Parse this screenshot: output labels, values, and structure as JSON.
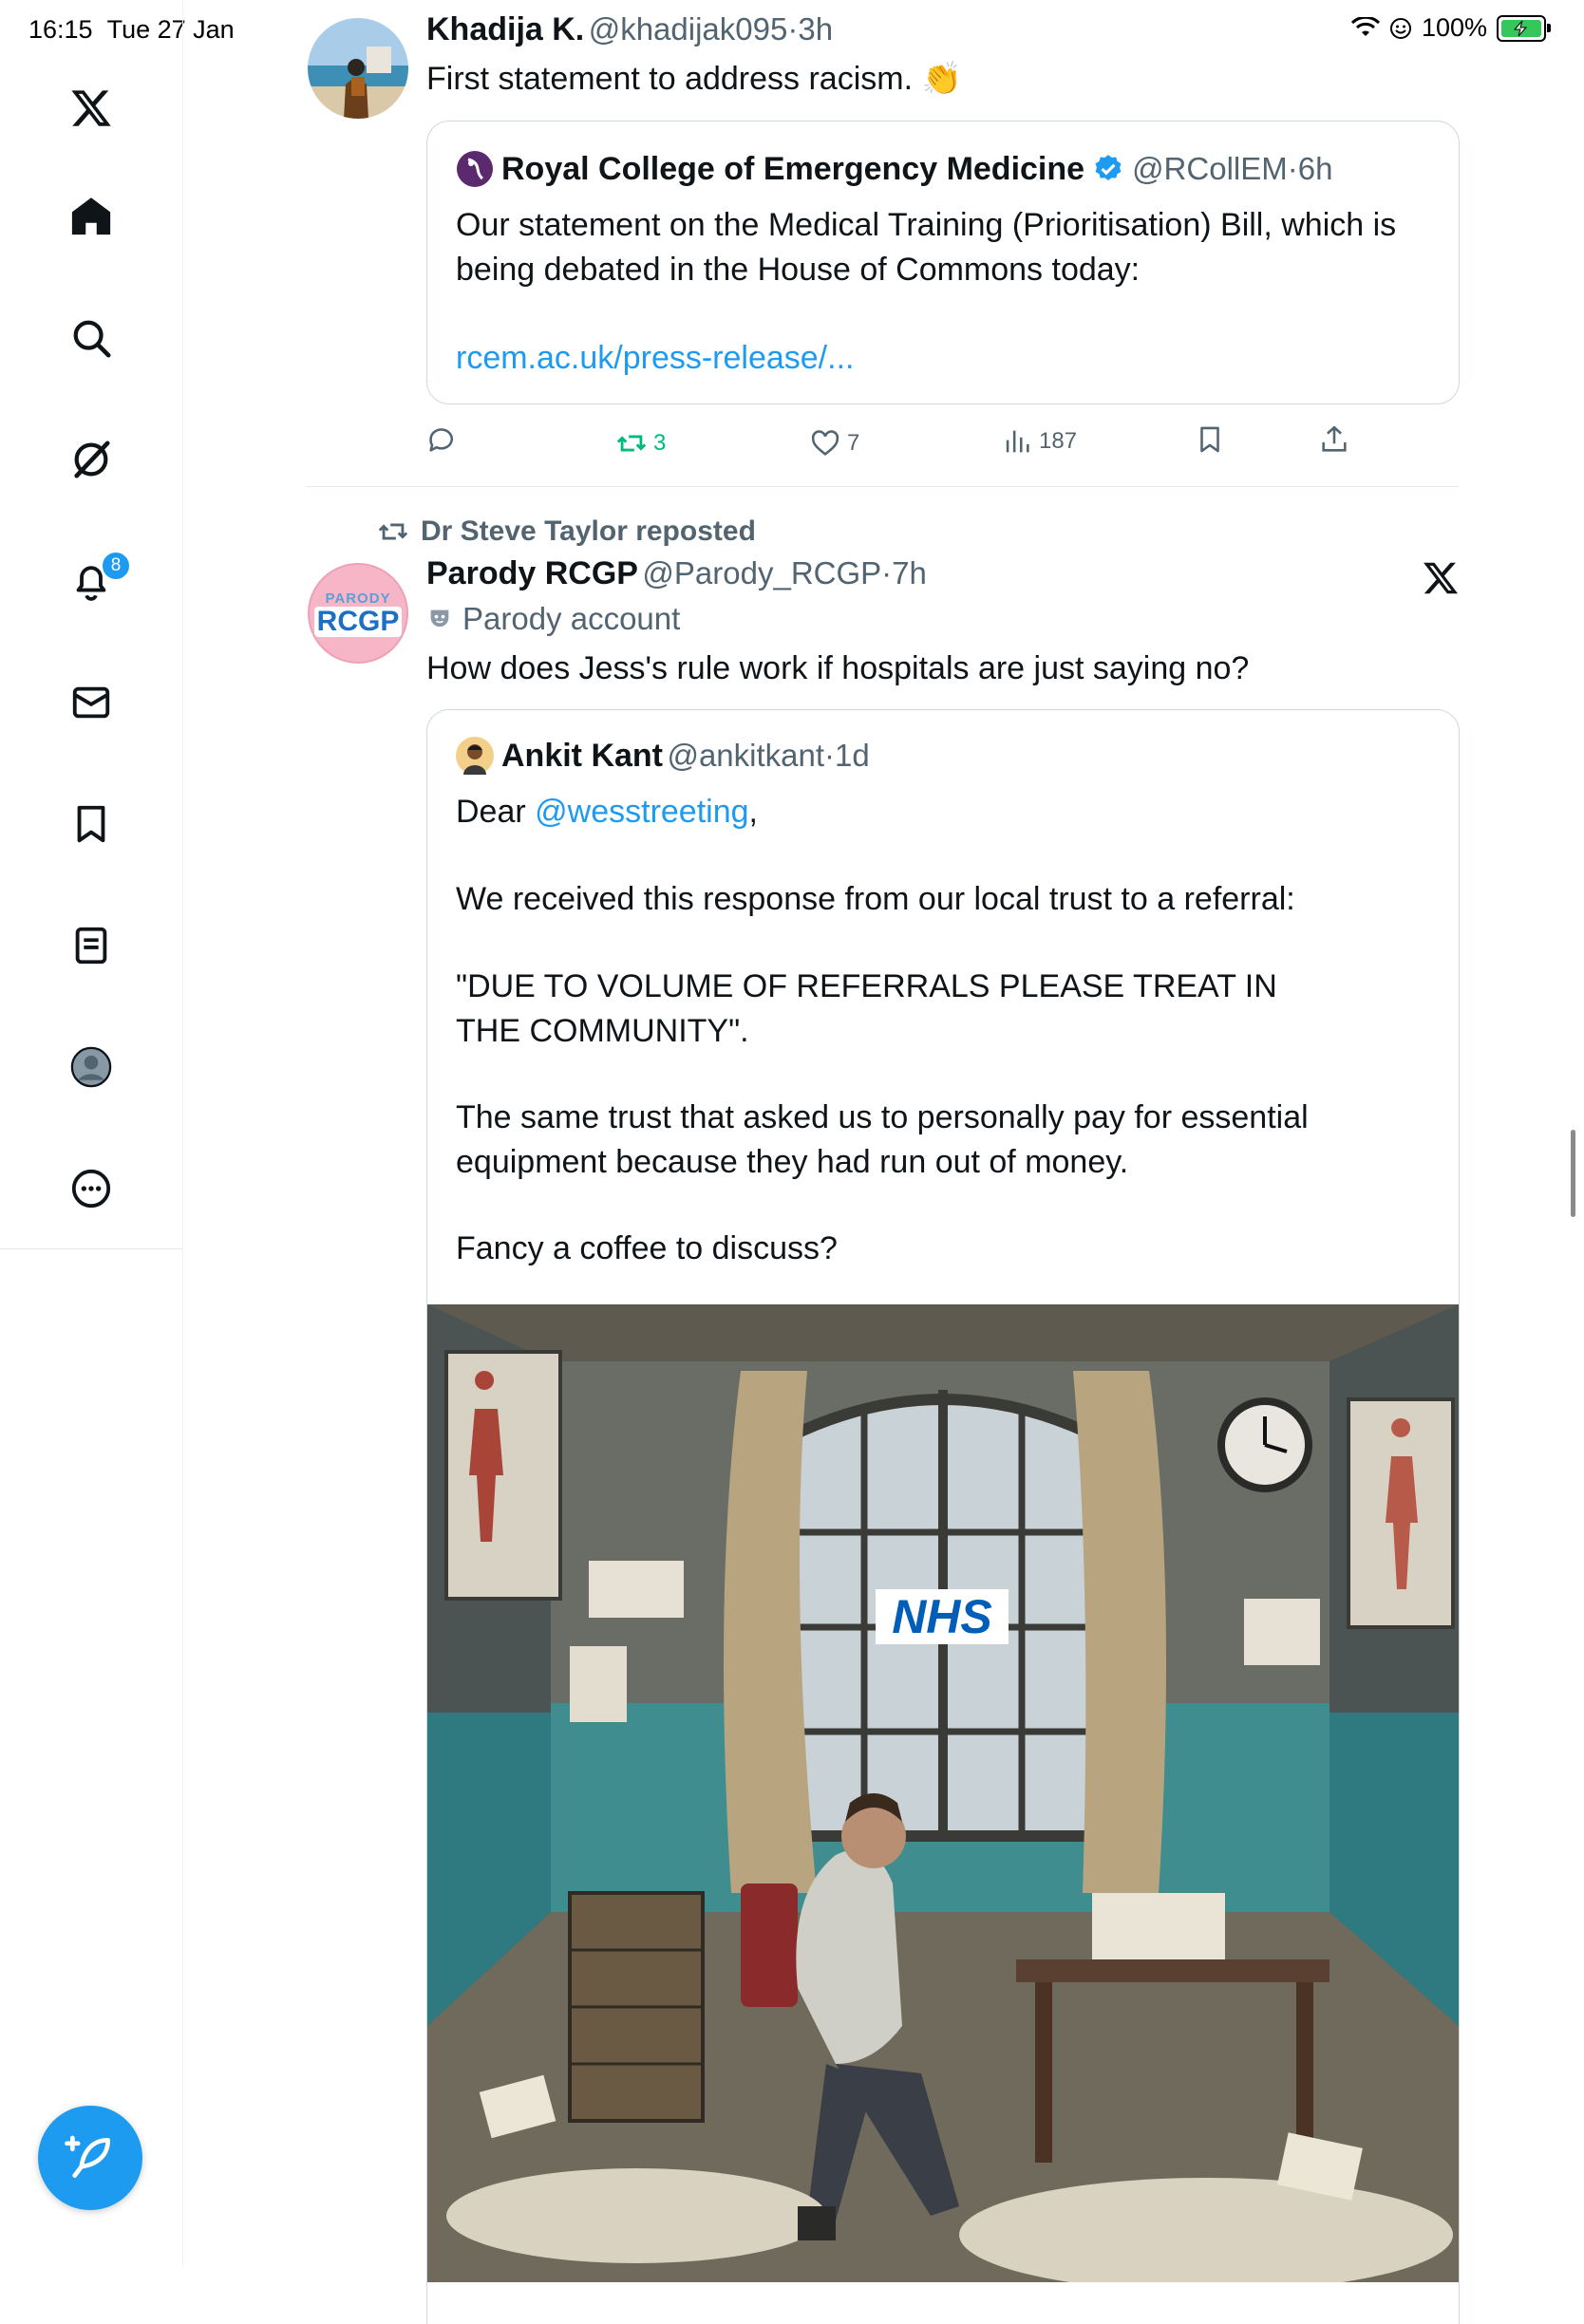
{
  "status_bar": {
    "time": "16:15",
    "date": "Tue 27 Jan",
    "battery": "100%"
  },
  "sidebar": {
    "items": [
      {
        "name": "home",
        "icon": "home-icon"
      },
      {
        "name": "search",
        "icon": "search-icon"
      },
      {
        "name": "grok",
        "icon": "grok-icon"
      },
      {
        "name": "notifications",
        "icon": "bell-icon",
        "badge": "8"
      },
      {
        "name": "messages",
        "icon": "mail-icon"
      },
      {
        "name": "bookmarks",
        "icon": "bookmark-icon"
      },
      {
        "name": "lists",
        "icon": "list-icon"
      },
      {
        "name": "profile",
        "icon": "profile-icon"
      },
      {
        "name": "more",
        "icon": "more-icon"
      }
    ],
    "accent": "#1d9bf0"
  },
  "tweet1": {
    "name": "Khadija K.",
    "handle": "@khadijak095",
    "time": "3h",
    "text": "First statement to address racism. 👏",
    "quote": {
      "name": "Royal College of Emergency Medicine",
      "handle": "@RCollEM",
      "time": "6h",
      "text": "Our statement on the Medical Training (Prioritisation) Bill, which is being debated in the House of Commons today:",
      "link": "rcem.ac.uk/press-release/..."
    },
    "actions": {
      "reposts": "3",
      "likes": "7",
      "views": "187"
    }
  },
  "tweet2": {
    "reposted_by": "Dr Steve Taylor reposted",
    "name": "Parody RCGP",
    "handle": "@Parody_RCGP",
    "time": "7h",
    "label": "Parody account",
    "avatar_top": "PARODY",
    "avatar_main": "RCGP",
    "text": "How does Jess's rule work if hospitals are just saying no?",
    "quote": {
      "name": "Ankit Kant",
      "handle": "@ankitkant",
      "time": "1d",
      "greeting": "Dear ",
      "mention": "@wesstreeting",
      "comma": ",",
      "p1": "We received this response from our local trust to a referral:",
      "p2": "\"DUE TO VOLUME OF REFERRALS PLEASE TREAT IN THE COMMUNITY\".",
      "p3": "The same trust that asked us to personally pay for essential equipment because they had run out of money.",
      "p4": "Fancy a coffee to discuss?",
      "image_sign": "NHS"
    }
  }
}
